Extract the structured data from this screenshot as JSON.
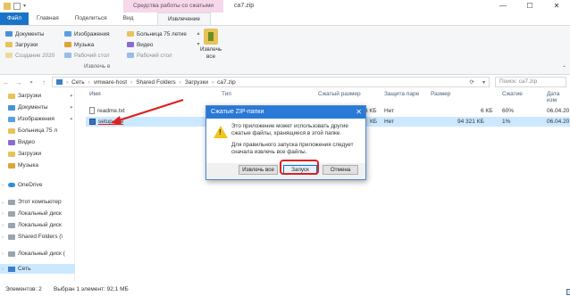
{
  "window": {
    "title": "ca7.zip",
    "context_tab": "Средства работы со сжатыми папками",
    "controls": [
      "—",
      "☐",
      "✕"
    ]
  },
  "tabs": {
    "file": "Файл",
    "home": "Главная",
    "share": "Поделиться",
    "view": "Вид",
    "extract": "Извлечение"
  },
  "ribbon": {
    "places": [
      "Документы",
      "Изображения",
      "Больница 75 летие",
      "Загрузки",
      "Музыка",
      "Видео",
      "Создание 2020",
      "Рабочий стол",
      "Рабочий стол"
    ],
    "extract_all_label": "Извлечь все",
    "group_label": "Извлечь в"
  },
  "address": {
    "crumbs": [
      "Сеть",
      "vmware-host",
      "Shared Folders",
      "Загрузки",
      "ca7.zip"
    ],
    "search_placeholder": "Поиск: ca7.zip"
  },
  "sidebar": {
    "items": [
      {
        "label": "Загрузки",
        "pinned": true
      },
      {
        "label": "Документы",
        "pinned": true
      },
      {
        "label": "Изображения",
        "pinned": true
      },
      {
        "label": "Больница 75 л",
        "pinned": false
      },
      {
        "label": "Видео",
        "pinned": false
      },
      {
        "label": "Загрузки",
        "pinned": false
      },
      {
        "label": "Музыка",
        "pinned": false
      },
      {
        "label": "OneDrive",
        "pinned": false
      },
      {
        "label": "Этот компьютер",
        "pinned": false
      },
      {
        "label": "Локальный диск",
        "pinned": false
      },
      {
        "label": "Локальный диск",
        "pinned": false
      },
      {
        "label": "Shared Folders (\\",
        "pinned": false
      },
      {
        "label": "Локальный диск (",
        "pinned": false
      },
      {
        "label": "Сеть",
        "pinned": false
      }
    ]
  },
  "table": {
    "headers": [
      "Имя",
      "Тип",
      "Сжатый размер",
      "Защита паре",
      "Размер",
      "Сжатие",
      "Дата изм"
    ],
    "rows": [
      {
        "name": "readme.txt",
        "type": "",
        "packed": "3 КБ",
        "protected": "Нет",
        "size": "6 КБ",
        "ratio": "60%",
        "date": "06.04.20"
      },
      {
        "name": "setup.exe",
        "type": "",
        "packed": "КБ",
        "protected": "Нет",
        "size": "94 321 КБ",
        "ratio": "1%",
        "date": "06.04.20"
      }
    ]
  },
  "dialog": {
    "title": "Сжатые ZIP-папки",
    "text1": "Это приложение может использовать другие сжатые файлы, хранящиеся в этой папке.",
    "text2": "Для правильного запуска приложения следует сначала извлечь все файлы.",
    "btn_extract": "Извлечь все",
    "btn_run": "Запуск",
    "btn_cancel": "Отмена"
  },
  "status": {
    "count": "Элементов: 2",
    "selection": "Выбран 1 элемент: 92,1 МБ"
  },
  "colors": {
    "accent": "#1a73c8",
    "selection": "#cce8ff",
    "annotation_red": "#e02020"
  }
}
